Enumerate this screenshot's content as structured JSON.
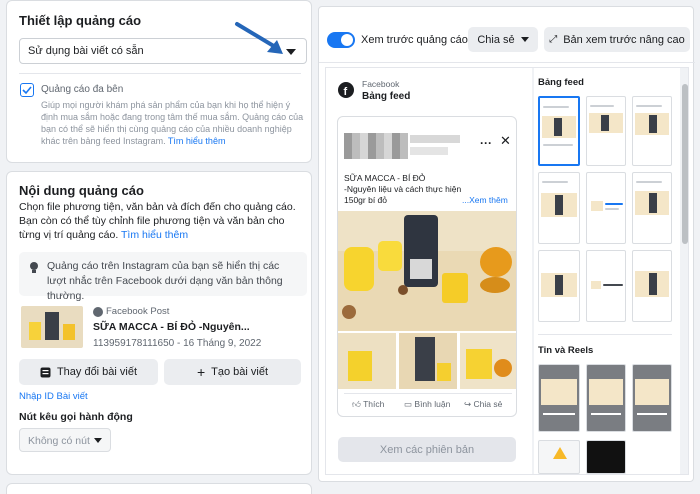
{
  "setup": {
    "title": "Thiết lập quảng cáo",
    "select_value": "Sử dụng bài viết có sẵn",
    "multi_label": "Quảng cáo đa bên",
    "multi_desc": "Giúp mọi người khám phá sản phẩm của bạn khi họ thể hiện ý định mua sắm hoặc đang trong tâm thế mua sắm. Quảng cáo của bạn có thể sẽ hiển thị cùng quảng cáo của nhiều doanh nghiệp khác trên bảng feed Instagram.",
    "learn_more": "Tìm hiểu thêm"
  },
  "content": {
    "title": "Nội dung quảng cáo",
    "desc": "Chọn file phương tiện, văn bản và đích đến cho quảng cáo. Bạn còn có thể tùy chỉnh file phương tiện và văn bản cho từng vị trí quảng cáo.",
    "learn_more": "Tìm hiểu thêm",
    "notice": "Quảng cáo trên Instagram của bạn sẽ hiển thị các lượt nhắc trên Facebook dưới dạng văn bản thông thường.",
    "post_source": "Facebook Post",
    "post_title": "SỮA MACCA - BÍ ĐỎ -Nguyên...",
    "post_meta": "113959178111650 - 16 Tháng 9, 2022",
    "change_post": "Thay đổi bài viết",
    "create_post": "Tạo bài viết",
    "enter_id": "Nhập ID Bài viết",
    "cta_label": "Nút kêu gọi hành động",
    "cta_value": "Không có nút"
  },
  "preview": {
    "toggle_label": "Xem trước quảng cáo",
    "toggle_on": true,
    "share": "Chia sẻ",
    "advanced": "Bản xem trước nâng cao",
    "platform": "Facebook",
    "placement": "Bảng feed",
    "post_text_line1": "SỮA MACCA - BÍ ĐỎ",
    "post_text_line2": "-Nguyên liệu và cách thực hiện",
    "post_text_line3": "150gr bí đỏ",
    "see_more": "...Xem thêm",
    "like": "Thích",
    "comment": "Bình luận",
    "share_action": "Chia sẻ",
    "variants_button": "Xem các phiên bản",
    "feed_section": "Bảng feed",
    "reels_section": "Tin và Reels"
  },
  "colors": {
    "accent": "#1877f2",
    "arrow": "#2566b8",
    "toggle": "#1877f2"
  }
}
